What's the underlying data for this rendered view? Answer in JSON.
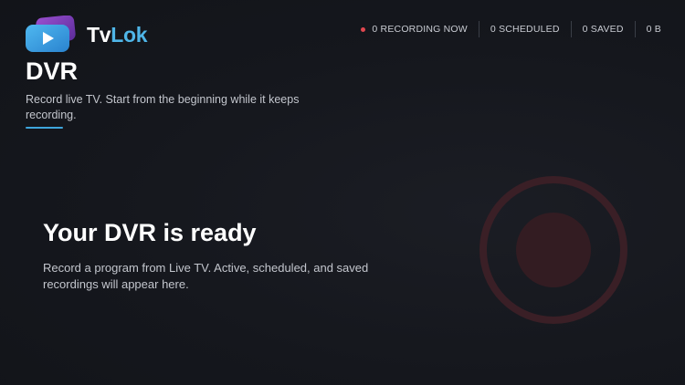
{
  "app": {
    "name_part1": "Tv",
    "name_part2": "Lok"
  },
  "status": {
    "recording_now": "0 RECORDING NOW",
    "scheduled": "0 SCHEDULED",
    "saved": "0 SAVED",
    "storage": "0 B"
  },
  "header": {
    "title": "DVR",
    "subtitle": "Record live TV. Start from the beginning while it keeps recording."
  },
  "empty_state": {
    "title": "Your DVR is ready",
    "description": "Record a program from Live TV. Active, scheduled, and saved recordings will appear here."
  },
  "colors": {
    "accent_blue": "#3ea6dc",
    "logo_purple": "#7b3fb6",
    "recording_red": "#e0474f",
    "record_ring": "#3a1f26"
  },
  "icons": {
    "logo": "play-icon",
    "recording_indicator": "recording-dot-icon",
    "illustration": "record-button-icon"
  }
}
